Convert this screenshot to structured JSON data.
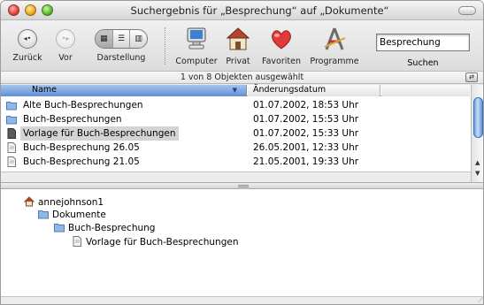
{
  "window": {
    "title": "Suchergebnis für „Besprechung“ auf „Dokumente“"
  },
  "toolbar": {
    "back_label": "Zurück",
    "forward_label": "Vor",
    "view_label": "Darstellung",
    "computer_label": "Computer",
    "home_label": "Privat",
    "favorites_label": "Favoriten",
    "applications_label": "Programme",
    "search_value": "Besprechung",
    "search_label": "Suchen",
    "back_icon": "back-arrow-icon",
    "forward_icon": "forward-arrow-icon",
    "view_modes": [
      "icon-view",
      "list-view",
      "column-view"
    ],
    "active_view": "icon-view"
  },
  "status": {
    "text": "1 von 8 Objekten ausgewählt"
  },
  "list": {
    "headers": {
      "name": "Name",
      "date": "Änderungsdatum"
    },
    "rows": [
      {
        "name": "Alte Buch-Besprechungen",
        "date": "01.07.2002, 18:53 Uhr",
        "icon": "folder-icon",
        "selected": false
      },
      {
        "name": "Buch-Besprechungen",
        "date": "01.07.2002, 15:53 Uhr",
        "icon": "folder-icon",
        "selected": false
      },
      {
        "name": "Vorlage für Buch-Besprechungen",
        "date": "01.07.2002, 15:33 Uhr",
        "icon": "template-document-icon",
        "selected": true
      },
      {
        "name": "Buch-Besprechung 26.05",
        "date": "26.05.2001, 12:33 Uhr",
        "icon": "document-icon",
        "selected": false
      },
      {
        "name": "Buch-Besprechung 21.05",
        "date": "21.05.2001, 19:33 Uhr",
        "icon": "document-icon",
        "selected": false
      }
    ]
  },
  "path": {
    "items": [
      {
        "label": "annejohnson1",
        "icon": "home-icon",
        "level": 0
      },
      {
        "label": "Dokumente",
        "icon": "folder-icon",
        "level": 1
      },
      {
        "label": "Buch-Besprechung",
        "icon": "folder-icon",
        "level": 2
      },
      {
        "label": "Vorlage für Buch-Besprechungen",
        "icon": "document-icon",
        "level": 3
      }
    ]
  },
  "colors": {
    "header_accent": "#5f8fd8",
    "folder": "#8fb8e8",
    "favorites_heart": "#e03a3a"
  }
}
